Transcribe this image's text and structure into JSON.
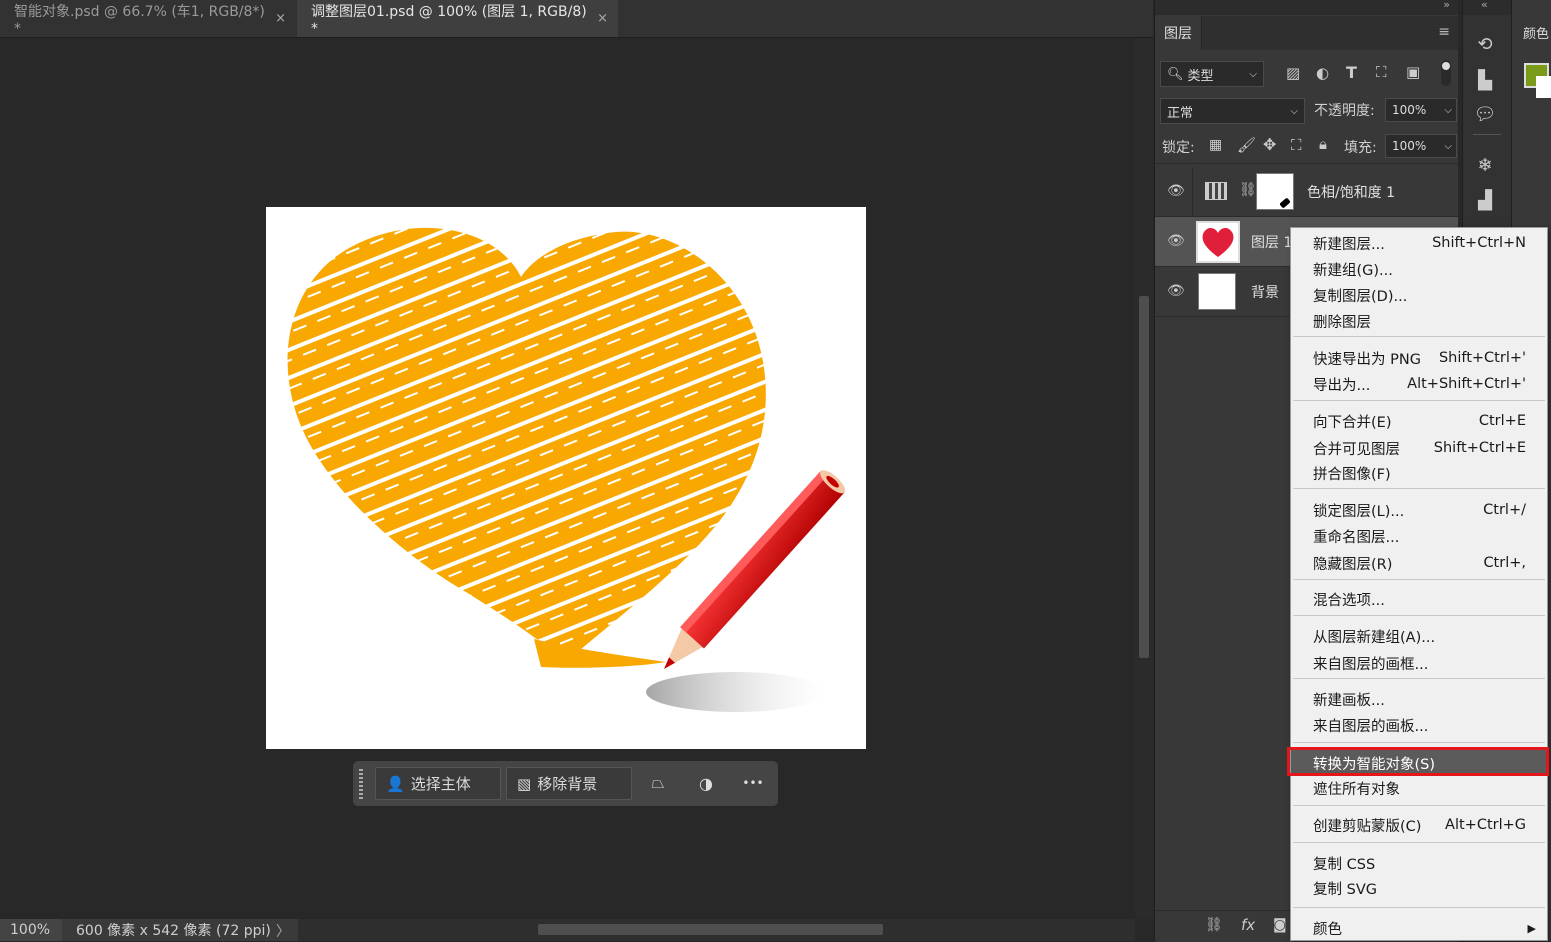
{
  "tabs": [
    {
      "label": "智能对象.psd @ 66.7% (车1, RGB/8*) *",
      "close": "×"
    },
    {
      "label": "调整图层01.psd @ 100% (图层 1, RGB/8) *",
      "close": "×"
    }
  ],
  "status": {
    "zoom": "100%",
    "doc_info": "600 像素 x 542 像素 (72 ppi)",
    "arrow": "〉"
  },
  "taskbar": {
    "select_subject": "选择主体",
    "remove_bg": "移除背景",
    "more": "•••"
  },
  "layers_panel": {
    "tab_label": "图层",
    "filter": "类型",
    "blend_mode": "正常",
    "opacity_label": "不透明度:",
    "opacity_value": "100%",
    "lock_label": "锁定:",
    "fill_label": "填充:",
    "fill_value": "100%",
    "layers": [
      {
        "name": "色相/饱和度 1"
      },
      {
        "name": "图层 1"
      },
      {
        "name": "背景"
      }
    ],
    "footer_fx": "fx"
  },
  "color_panel": {
    "label": "颜色",
    "swatch": "#7a9a1a"
  },
  "context_menu": {
    "groups": [
      [
        {
          "label": "新建图层...",
          "shortcut": "Shift+Ctrl+N"
        },
        {
          "label": "新建组(G)...",
          "shortcut": ""
        },
        {
          "label": "复制图层(D)...",
          "shortcut": ""
        },
        {
          "label": "删除图层",
          "shortcut": ""
        }
      ],
      [
        {
          "label": "快速导出为 PNG",
          "shortcut": "Shift+Ctrl+'"
        },
        {
          "label": "导出为...",
          "shortcut": "Alt+Shift+Ctrl+'"
        }
      ],
      [
        {
          "label": "向下合并(E)",
          "shortcut": "Ctrl+E"
        },
        {
          "label": "合并可见图层",
          "shortcut": "Shift+Ctrl+E"
        },
        {
          "label": "拼合图像(F)",
          "shortcut": ""
        }
      ],
      [
        {
          "label": "锁定图层(L)...",
          "shortcut": "Ctrl+/"
        },
        {
          "label": "重命名图层...",
          "shortcut": ""
        },
        {
          "label": "隐藏图层(R)",
          "shortcut": "Ctrl+,"
        }
      ],
      [
        {
          "label": "混合选项...",
          "shortcut": ""
        }
      ],
      [
        {
          "label": "从图层新建组(A)...",
          "shortcut": ""
        },
        {
          "label": "来自图层的画框...",
          "shortcut": ""
        }
      ],
      [
        {
          "label": "新建画板...",
          "shortcut": ""
        },
        {
          "label": "来自图层的画板...",
          "shortcut": ""
        }
      ],
      [
        {
          "label": "转换为智能对象(S)",
          "shortcut": ""
        },
        {
          "label": "遮住所有对象",
          "shortcut": ""
        }
      ],
      [
        {
          "label": "创建剪贴蒙版(C)",
          "shortcut": "Alt+Ctrl+G"
        }
      ],
      [
        {
          "label": "复制 CSS",
          "shortcut": ""
        },
        {
          "label": "复制 SVG",
          "shortcut": ""
        }
      ],
      [
        {
          "label": "颜色",
          "shortcut": "▶"
        }
      ]
    ],
    "highlighted": "转换为智能对象(S)"
  }
}
